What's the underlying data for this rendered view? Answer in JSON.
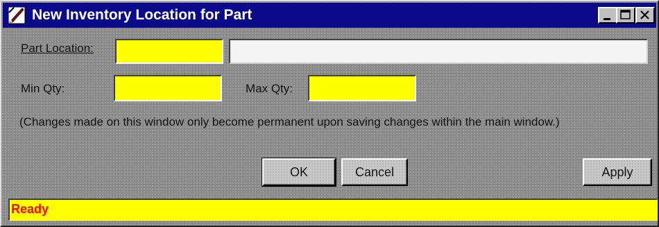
{
  "window": {
    "title": "New Inventory Location for Part",
    "icon": "pencil-ruler-icon",
    "controls": {
      "minimize": "minimize-icon",
      "maximize": "maximize-icon",
      "close": "close-icon"
    }
  },
  "form": {
    "part_location_label": "Part Location:",
    "part_location_value": "",
    "part_location_description": "",
    "min_qty_label": "Min Qty:",
    "min_qty_value": "",
    "max_qty_label": "Max Qty:",
    "max_qty_value": ""
  },
  "note": "(Changes made on this window only become permanent upon saving changes within the main window.)",
  "buttons": {
    "ok": "OK",
    "cancel": "Cancel",
    "apply": "Apply"
  },
  "status": {
    "text": "Ready"
  },
  "colors": {
    "title_bar": "#0a0a8a",
    "required_field": "#ffff00",
    "status_bar": "#ffff00",
    "status_text": "#ff0000"
  }
}
